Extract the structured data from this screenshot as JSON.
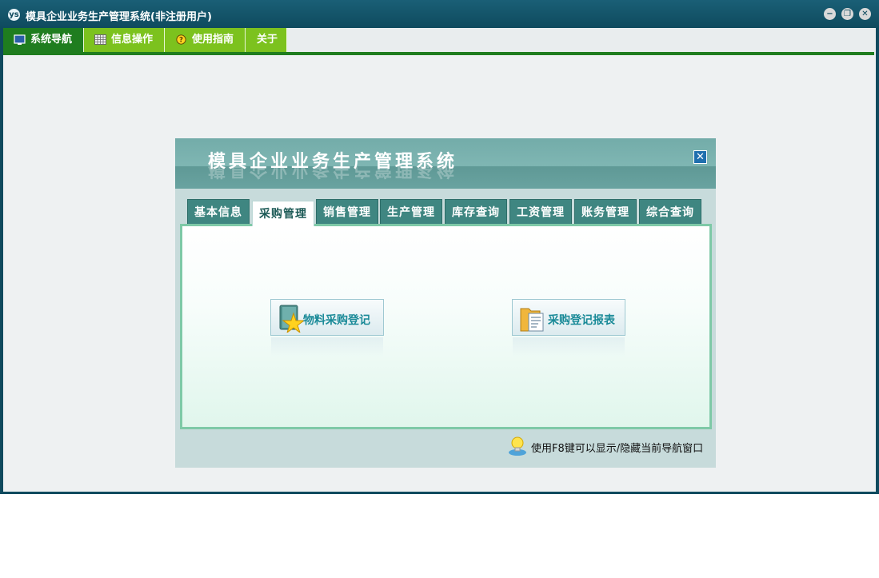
{
  "window": {
    "logo_glyph": "ys",
    "title": "模具企业业务生产管理系统(非注册用户)",
    "controls": {
      "minimize": "−",
      "restore": "❐",
      "close": "✕"
    }
  },
  "menubar": {
    "items": [
      {
        "label": "系统导航",
        "icon": "monitor-icon"
      },
      {
        "label": "信息操作",
        "icon": "grid-icon"
      },
      {
        "label": "使用指南",
        "icon": "help-icon"
      },
      {
        "label": "关于"
      }
    ]
  },
  "dialog": {
    "title": "模具企业业务生产管理系统",
    "close_glyph": "✕",
    "tabs": [
      {
        "label": "基本信息"
      },
      {
        "label": "采购管理",
        "active": true
      },
      {
        "label": "销售管理"
      },
      {
        "label": "生产管理"
      },
      {
        "label": "库存查询"
      },
      {
        "label": "工资管理"
      },
      {
        "label": "账务管理"
      },
      {
        "label": "综合查询"
      }
    ],
    "buttons": [
      {
        "label": "物料采购登记",
        "icon": "star-book-icon"
      },
      {
        "label": "采购登记报表",
        "icon": "folder-document-icon"
      }
    ],
    "hint": "使用F8键可以显示/隐藏当前导航窗口"
  },
  "colors": {
    "titlebar": "#0e4a5d",
    "menu_active": "#1f7d1f",
    "menu_item": "#7cc21e",
    "tab": "#3f8681",
    "panel_border": "#7ec9a7",
    "button_text": "#1a8a98"
  }
}
